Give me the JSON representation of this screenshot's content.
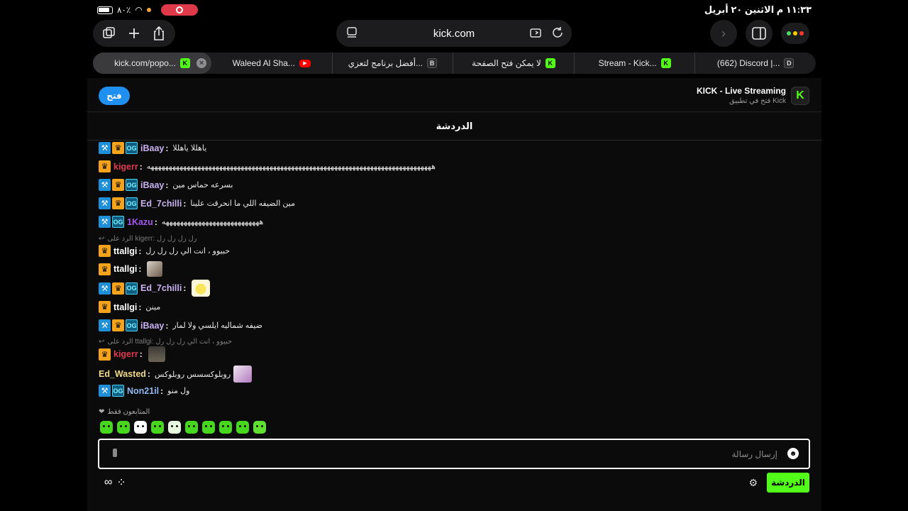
{
  "status_bar": {
    "battery_text": "٨٠٪",
    "datetime": "١١:٣٣ م  الاثنين ٢٠ أبريل"
  },
  "toolbar": {
    "url": "kick.com"
  },
  "tabs": [
    {
      "title": "kick.com/popo...",
      "favicon": "K",
      "active": true
    },
    {
      "title": "Waleed Al Sha...",
      "favicon": "▶",
      "active": false
    },
    {
      "title": "أفضل برنامج لتعزي...",
      "favicon": "B",
      "active": false
    },
    {
      "title": "لا يمكن فتح الصفحة",
      "favicon": "K",
      "active": false
    },
    {
      "title": "Stream - Kick...",
      "favicon": "K",
      "active": false
    },
    {
      "title": "(662) Discord |...",
      "favicon": "D",
      "active": false
    }
  ],
  "banner": {
    "open_label": "فتح",
    "app_name": "KICK - Live Streaming",
    "app_sub": "فتح في تطبيق Kick",
    "app_icon_letter": "K"
  },
  "chat": {
    "header": "الدردشة",
    "messages": [
      {
        "user": "iBaay",
        "color": "#c9b1f0",
        "text": "ياهللا ياهللا"
      },
      {
        "user": "kigerr",
        "color": "#e0384f",
        "text": "هههههههههههههههههههههههههههههههههههههههههههههههههههههههههههههههههههههههههههههههه"
      },
      {
        "user": "iBaay",
        "color": "#c9b1f0",
        "text": "بسرعه حماس مين"
      },
      {
        "user": "Ed_7chilli",
        "color": "#c9b1f0",
        "text": "مين الضيفه اللي ما انحرقت علينا"
      },
      {
        "user": "1Kazu",
        "color": "#a457f0",
        "text": "هههههههههههههههههههههههههههه"
      },
      {
        "user": "ttallgi",
        "color": "#ffffff",
        "text": "حبيوو ، انت الي رل رل رل"
      },
      {
        "user": "ttallgi",
        "color": "#ffffff",
        "text": ""
      },
      {
        "user": "Ed_7chilli",
        "color": "#c9b1f0",
        "text": ""
      },
      {
        "user": "ttallgi",
        "color": "#ffffff",
        "text": "مينن"
      },
      {
        "user": "iBaay",
        "color": "#c9b1f0",
        "text": "ضيفه شماليه ايلسي ولا لمار"
      },
      {
        "user": "kigerr",
        "color": "#e0384f",
        "text": ""
      },
      {
        "user": "Ed_Wasted",
        "color": "#f0d98a",
        "text": "روبلوكسسس روبلوكس"
      },
      {
        "user": "Non21il",
        "color": "#8fb8f0",
        "text": "ول منو"
      }
    ],
    "replies": [
      {
        "text": "الرد على kigerr: رل رل رل رل"
      },
      {
        "text": "الرد على ttallgi: حبيوو ، انت الي رل رل رل"
      }
    ],
    "followers_only": "المتابعون فقط",
    "input_placeholder": "إرسال رسالة",
    "send_label": "الدردشة"
  }
}
